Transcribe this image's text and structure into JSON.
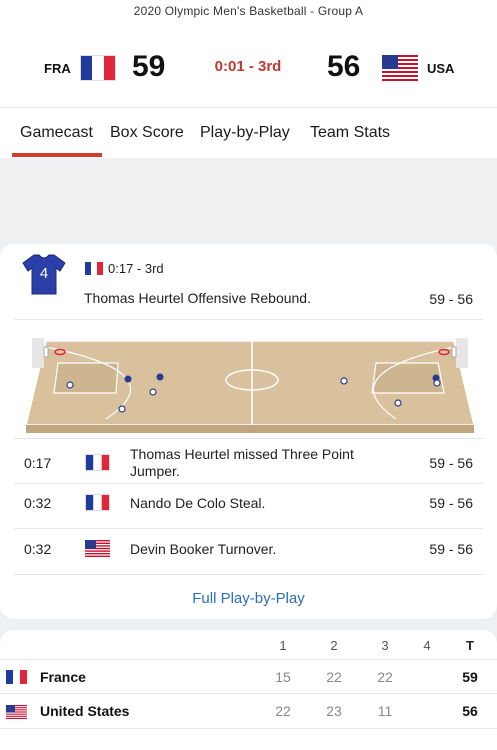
{
  "header": {
    "event_title": "2020 Olympic Men's Basketball - Group A",
    "home": {
      "abbr": "FRA",
      "score": "59",
      "flag": "france-flag"
    },
    "away": {
      "abbr": "USA",
      "score": "56",
      "flag": "usa-flag"
    },
    "clock": "0:01 - 3rd",
    "clock_color": "#c0392b"
  },
  "tabs": [
    {
      "label": "Gamecast",
      "active": true
    },
    {
      "label": "Box Score"
    },
    {
      "label": "Play-by-Play"
    },
    {
      "label": "Team Stats"
    }
  ],
  "accent": "#d33b2c",
  "last_play": {
    "jersey_number": "4",
    "jersey_color": "#2b3fa8",
    "meta": "0:17 - 3rd",
    "description": "Thomas Heurtel Offensive Rebound.",
    "score": "59 - 56"
  },
  "plays": [
    {
      "time": "0:17",
      "team_flag": "france-flag",
      "description": "Thomas Heurtel missed Three Point Jumper.",
      "score": "59 - 56"
    },
    {
      "time": "0:32",
      "team_flag": "france-flag",
      "description": "Nando De Colo Steal.",
      "score": "59 - 56"
    },
    {
      "time": "0:32",
      "team_flag": "usa-flag",
      "description": "Devin Booker Turnover.",
      "score": "59 - 56"
    }
  ],
  "full_pbp_link": "Full Play-by-Play",
  "linescore": {
    "headers": [
      "1",
      "2",
      "3",
      "4",
      "T"
    ],
    "teams": [
      {
        "name": "France",
        "flag": "france-flag",
        "quarters": [
          "15",
          "22",
          "22",
          ""
        ],
        "total": "59"
      },
      {
        "name": "United States",
        "flag": "usa-flag",
        "quarters": [
          "22",
          "23",
          "11",
          ""
        ],
        "total": "56"
      }
    ]
  }
}
